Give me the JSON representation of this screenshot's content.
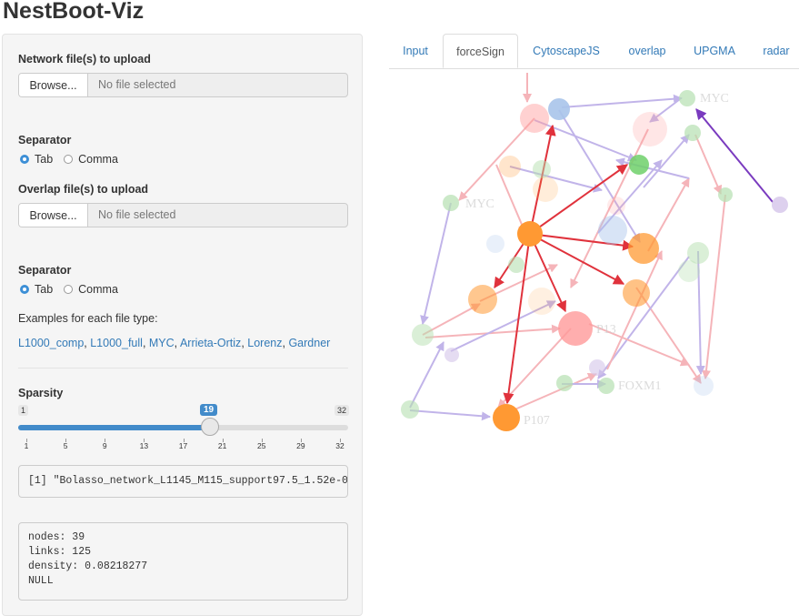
{
  "app": {
    "title": "NestBoot-Viz"
  },
  "sidebar": {
    "network_label": "Network file(s) to upload",
    "network_browse": "Browse...",
    "network_status": "No file selected",
    "sep1_label": "Separator",
    "sep1_options": [
      "Tab",
      "Comma"
    ],
    "sep1_selected": "Tab",
    "overlap_label": "Overlap file(s) to upload",
    "overlap_browse": "Browse...",
    "overlap_status": "No file selected",
    "sep2_label": "Separator",
    "sep2_options": [
      "Tab",
      "Comma"
    ],
    "sep2_selected": "Tab",
    "examples_label": "Examples for each file type:",
    "examples": [
      "L1000_comp",
      "L1000_full",
      "MYC",
      "Arrieta-Ortiz",
      "Lorenz",
      "Gardner"
    ],
    "sparsity_label": "Sparsity",
    "slider": {
      "min": "1",
      "max": "32",
      "value": "19",
      "value_fraction": 0.5806,
      "ticks": [
        "1",
        "5",
        "9",
        "13",
        "17",
        "21",
        "25",
        "29",
        "32"
      ]
    },
    "output_line": "[1] \"Bolasso_network_L1145_M115_support97.5_1.52e-0",
    "stats": {
      "nodes": "nodes: 39",
      "links": "links: 125",
      "density": "density: 0.08218277",
      "null": "NULL"
    }
  },
  "tabs": [
    "Input",
    "forceSign",
    "CytoscapeJS",
    "overlap",
    "UPGMA",
    "radar"
  ],
  "active_tab": "forceSign",
  "graph": {
    "node_labels": [
      "MYC",
      "MYC",
      "P107",
      "P13",
      "FOXM1"
    ],
    "colors": {
      "orange": "#ff9933",
      "pink": "#ff9a9a",
      "blue": "#a9c4ea",
      "green": "#b5e0b0",
      "lavender": "#d4c4ea",
      "red_edge": "#e0323c",
      "purple_edge": "#7a3bbf",
      "faint_red_edge": "#f4a8ad",
      "faint_blue_edge": "#b7a8e6"
    }
  }
}
